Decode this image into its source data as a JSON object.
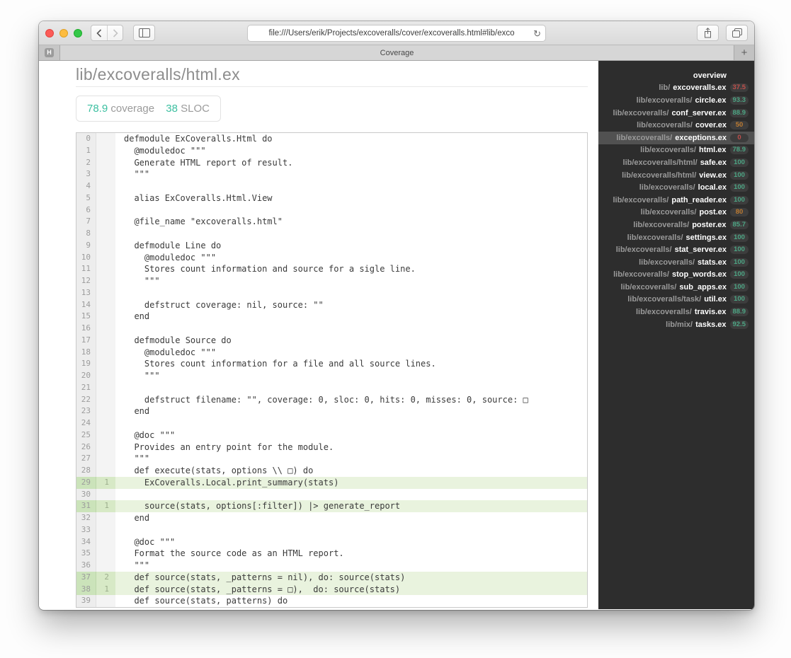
{
  "colors": {
    "coverage_teal": "#3bbfa0",
    "sidebar_green": "#4da584",
    "sidebar_orange": "#bd7b31",
    "sidebar_red": "#bf4f4b",
    "covered_line_bg": "#e9f3de",
    "sidebar_bg": "#2d2d2d",
    "traffic_red": "#fc5b57",
    "traffic_yellow": "#fdbc40",
    "traffic_green": "#34c748"
  },
  "browser": {
    "url": "file:///Users/erik/Projects/excoveralls/cover/excoveralls.html#lib/exco",
    "reload_glyph": "↻",
    "pinned_tab_label": "H",
    "tab_title": "Coverage",
    "new_tab_glyph": "+"
  },
  "page": {
    "title": "lib/excoveralls/html.ex",
    "badge": {
      "coverage_value": "78.9",
      "coverage_label": "coverage",
      "sloc_value": "38",
      "sloc_label": "SLOC"
    }
  },
  "code": {
    "lines": [
      {
        "n": 0,
        "hits": "",
        "covered": false,
        "text": "defmodule ExCoveralls.Html do"
      },
      {
        "n": 1,
        "hits": "",
        "covered": false,
        "text": "  @moduledoc \"\"\""
      },
      {
        "n": 2,
        "hits": "",
        "covered": false,
        "text": "  Generate HTML report of result."
      },
      {
        "n": 3,
        "hits": "",
        "covered": false,
        "text": "  \"\"\""
      },
      {
        "n": 4,
        "hits": "",
        "covered": false,
        "text": ""
      },
      {
        "n": 5,
        "hits": "",
        "covered": false,
        "text": "  alias ExCoveralls.Html.View"
      },
      {
        "n": 6,
        "hits": "",
        "covered": false,
        "text": ""
      },
      {
        "n": 7,
        "hits": "",
        "covered": false,
        "text": "  @file_name \"excoveralls.html\""
      },
      {
        "n": 8,
        "hits": "",
        "covered": false,
        "text": ""
      },
      {
        "n": 9,
        "hits": "",
        "covered": false,
        "text": "  defmodule Line do"
      },
      {
        "n": 10,
        "hits": "",
        "covered": false,
        "text": "    @moduledoc \"\"\""
      },
      {
        "n": 11,
        "hits": "",
        "covered": false,
        "text": "    Stores count information and source for a sigle line."
      },
      {
        "n": 12,
        "hits": "",
        "covered": false,
        "text": "    \"\"\""
      },
      {
        "n": 13,
        "hits": "",
        "covered": false,
        "text": ""
      },
      {
        "n": 14,
        "hits": "",
        "covered": false,
        "text": "    defstruct coverage: nil, source: \"\""
      },
      {
        "n": 15,
        "hits": "",
        "covered": false,
        "text": "  end"
      },
      {
        "n": 16,
        "hits": "",
        "covered": false,
        "text": ""
      },
      {
        "n": 17,
        "hits": "",
        "covered": false,
        "text": "  defmodule Source do"
      },
      {
        "n": 18,
        "hits": "",
        "covered": false,
        "text": "    @moduledoc \"\"\""
      },
      {
        "n": 19,
        "hits": "",
        "covered": false,
        "text": "    Stores count information for a file and all source lines."
      },
      {
        "n": 20,
        "hits": "",
        "covered": false,
        "text": "    \"\"\""
      },
      {
        "n": 21,
        "hits": "",
        "covered": false,
        "text": ""
      },
      {
        "n": 22,
        "hits": "",
        "covered": false,
        "text": "    defstruct filename: \"\", coverage: 0, sloc: 0, hits: 0, misses: 0, source: □"
      },
      {
        "n": 23,
        "hits": "",
        "covered": false,
        "text": "  end"
      },
      {
        "n": 24,
        "hits": "",
        "covered": false,
        "text": ""
      },
      {
        "n": 25,
        "hits": "",
        "covered": false,
        "text": "  @doc \"\"\""
      },
      {
        "n": 26,
        "hits": "",
        "covered": false,
        "text": "  Provides an entry point for the module."
      },
      {
        "n": 27,
        "hits": "",
        "covered": false,
        "text": "  \"\"\""
      },
      {
        "n": 28,
        "hits": "",
        "covered": false,
        "text": "  def execute(stats, options \\\\ □) do"
      },
      {
        "n": 29,
        "hits": "1",
        "covered": true,
        "text": "    ExCoveralls.Local.print_summary(stats)"
      },
      {
        "n": 30,
        "hits": "",
        "covered": false,
        "text": ""
      },
      {
        "n": 31,
        "hits": "1",
        "covered": true,
        "text": "    source(stats, options[:filter]) |> generate_report"
      },
      {
        "n": 32,
        "hits": "",
        "covered": false,
        "text": "  end"
      },
      {
        "n": 33,
        "hits": "",
        "covered": false,
        "text": ""
      },
      {
        "n": 34,
        "hits": "",
        "covered": false,
        "text": "  @doc \"\"\""
      },
      {
        "n": 35,
        "hits": "",
        "covered": false,
        "text": "  Format the source code as an HTML report."
      },
      {
        "n": 36,
        "hits": "",
        "covered": false,
        "text": "  \"\"\""
      },
      {
        "n": 37,
        "hits": "2",
        "covered": true,
        "text": "  def source(stats, _patterns = nil), do: source(stats)"
      },
      {
        "n": 38,
        "hits": "1",
        "covered": true,
        "text": "  def source(stats, _patterns = □),  do: source(stats)"
      },
      {
        "n": 39,
        "hits": "",
        "covered": false,
        "text": "  def source(stats, patterns) do"
      }
    ]
  },
  "sidebar": {
    "items": [
      {
        "dir": "",
        "name": "overview",
        "pct": null,
        "level": null,
        "highlighted": false
      },
      {
        "dir": "lib/",
        "name": "excoveralls.ex",
        "pct": "37.5",
        "level": "low",
        "highlighted": false
      },
      {
        "dir": "lib/excoveralls/",
        "name": "circle.ex",
        "pct": "93.3",
        "level": "high",
        "highlighted": false
      },
      {
        "dir": "lib/excoveralls/",
        "name": "conf_server.ex",
        "pct": "88.9",
        "level": "high",
        "highlighted": false
      },
      {
        "dir": "lib/excoveralls/",
        "name": "cover.ex",
        "pct": "50",
        "level": "mid",
        "highlighted": false
      },
      {
        "dir": "lib/excoveralls/",
        "name": "exceptions.ex",
        "pct": "0",
        "level": "low",
        "highlighted": true
      },
      {
        "dir": "lib/excoveralls/",
        "name": "html.ex",
        "pct": "78.9",
        "level": "high",
        "highlighted": false
      },
      {
        "dir": "lib/excoveralls/html/",
        "name": "safe.ex",
        "pct": "100",
        "level": "high",
        "highlighted": false
      },
      {
        "dir": "lib/excoveralls/html/",
        "name": "view.ex",
        "pct": "100",
        "level": "high",
        "highlighted": false
      },
      {
        "dir": "lib/excoveralls/",
        "name": "local.ex",
        "pct": "100",
        "level": "high",
        "highlighted": false
      },
      {
        "dir": "lib/excoveralls/",
        "name": "path_reader.ex",
        "pct": "100",
        "level": "high",
        "highlighted": false
      },
      {
        "dir": "lib/excoveralls/",
        "name": "post.ex",
        "pct": "80",
        "level": "mid",
        "highlighted": false
      },
      {
        "dir": "lib/excoveralls/",
        "name": "poster.ex",
        "pct": "85.7",
        "level": "high",
        "highlighted": false
      },
      {
        "dir": "lib/excoveralls/",
        "name": "settings.ex",
        "pct": "100",
        "level": "high",
        "highlighted": false
      },
      {
        "dir": "lib/excoveralls/",
        "name": "stat_server.ex",
        "pct": "100",
        "level": "high",
        "highlighted": false
      },
      {
        "dir": "lib/excoveralls/",
        "name": "stats.ex",
        "pct": "100",
        "level": "high",
        "highlighted": false
      },
      {
        "dir": "lib/excoveralls/",
        "name": "stop_words.ex",
        "pct": "100",
        "level": "high",
        "highlighted": false
      },
      {
        "dir": "lib/excoveralls/",
        "name": "sub_apps.ex",
        "pct": "100",
        "level": "high",
        "highlighted": false
      },
      {
        "dir": "lib/excoveralls/task/",
        "name": "util.ex",
        "pct": "100",
        "level": "high",
        "highlighted": false
      },
      {
        "dir": "lib/excoveralls/",
        "name": "travis.ex",
        "pct": "88.9",
        "level": "high",
        "highlighted": false
      },
      {
        "dir": "lib/mix/",
        "name": "tasks.ex",
        "pct": "92.5",
        "level": "high",
        "highlighted": false
      }
    ]
  }
}
